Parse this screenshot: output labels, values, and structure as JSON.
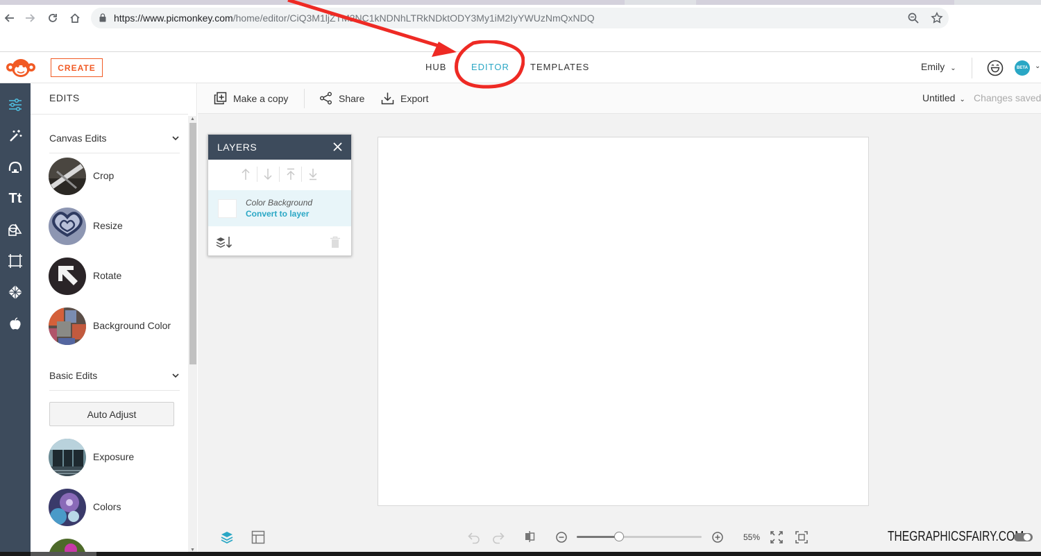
{
  "browser": {
    "url_main": "https://www.picmonkey.com",
    "url_rest": "/home/editor/CiQ3M1ljZTM2NC1kNDNhLTRkNDktODY3My1iM2IyYWUzNmQxNDQ"
  },
  "header": {
    "create_label": "CREATE",
    "nav": {
      "hub": "HUB",
      "editor": "EDITOR",
      "templates": "TEMPLATES"
    },
    "active_nav": "editor",
    "user_name": "Emily",
    "beta_label": "BETA",
    "accent_color": "#2aa7c5",
    "brand_color": "#f15a24"
  },
  "sidebar": {
    "rail_icons": [
      "sliders-icon",
      "magic-wand-icon",
      "touchup-face-icon",
      "text-icon",
      "graphics-icon",
      "frames-icon",
      "textures-icon",
      "themes-apple-icon"
    ],
    "text_icon_label": "Tt",
    "active_rail": "sliders-icon"
  },
  "edits_panel": {
    "title": "EDITS",
    "canvas_section": "Canvas Edits",
    "canvas_items": [
      "Crop",
      "Resize",
      "Rotate",
      "Background Color"
    ],
    "basic_section": "Basic Edits",
    "auto_adjust": "Auto Adjust",
    "basic_items": [
      "Exposure",
      "Colors"
    ]
  },
  "toolbar": {
    "make_copy": "Make a copy",
    "share": "Share",
    "export": "Export",
    "doc_title": "Untitled",
    "save_status": "Changes saved"
  },
  "layers": {
    "title": "LAYERS",
    "layer_name": "Color Background",
    "layer_action": "Convert to layer"
  },
  "bottom_bar": {
    "zoom_label": "55%",
    "zoom_fraction": 0.34,
    "watermark": "THEGRAPHICSFAIRY.COM"
  }
}
